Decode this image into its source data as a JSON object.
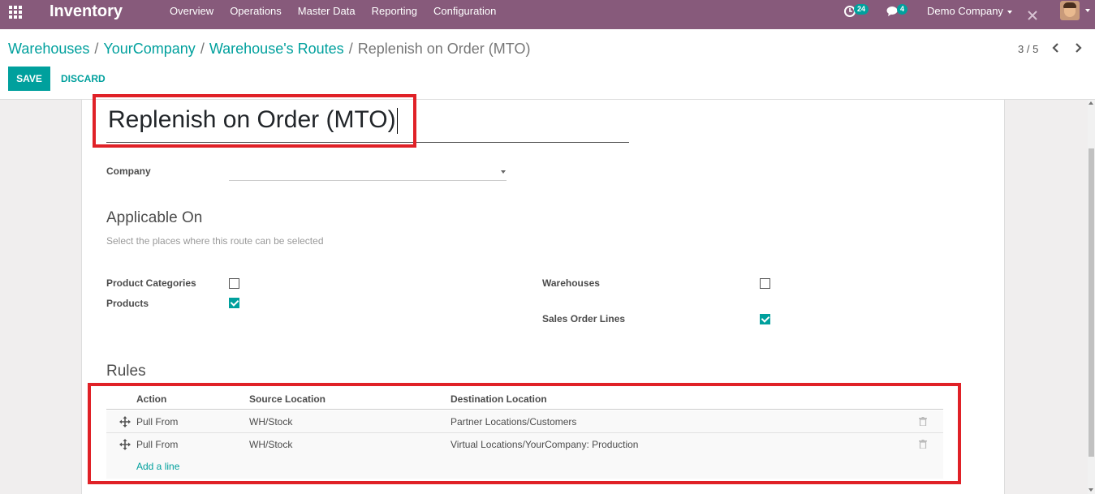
{
  "navbar": {
    "brand": "Inventory",
    "menu": [
      "Overview",
      "Operations",
      "Master Data",
      "Reporting",
      "Configuration"
    ],
    "activity_count": "24",
    "message_count": "4",
    "company": "Demo Company"
  },
  "breadcrumb": {
    "items": [
      "Warehouses",
      "YourCompany",
      "Warehouse's Routes"
    ],
    "current": "Replenish on Order (MTO)",
    "separator": "/"
  },
  "actions": {
    "save": "SAVE",
    "discard": "DISCARD"
  },
  "pager": {
    "text": "3 / 5"
  },
  "form": {
    "name": "Replenish on Order (MTO)",
    "company_label": "Company",
    "company_value": "",
    "applicable_title": "Applicable On",
    "applicable_hint": "Select the places where this route can be selected",
    "fields": {
      "product_categories": {
        "label": "Product Categories",
        "checked": false
      },
      "products": {
        "label": "Products",
        "checked": true
      },
      "warehouses": {
        "label": "Warehouses",
        "checked": false
      },
      "sales_order_lines": {
        "label": "Sales Order Lines",
        "checked": true
      }
    },
    "rules_title": "Rules",
    "rules": {
      "headers": [
        "Action",
        "Source Location",
        "Destination Location"
      ],
      "rows": [
        {
          "action": "Pull From",
          "source": "WH/Stock",
          "destination": "Partner Locations/Customers"
        },
        {
          "action": "Pull From",
          "source": "WH/Stock",
          "destination": "Virtual Locations/YourCompany: Production"
        }
      ],
      "add_line": "Add a line"
    }
  },
  "colors": {
    "navbar": "#875a7b",
    "accent": "#00a09d",
    "highlight": "#e02127"
  }
}
